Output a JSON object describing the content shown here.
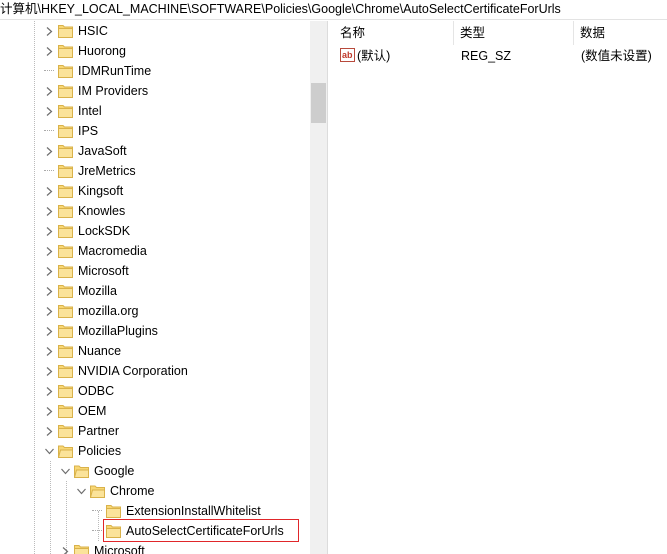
{
  "address": "计算机\\HKEY_LOCAL_MACHINE\\SOFTWARE\\Policies\\Google\\Chrome\\AutoSelectCertificateForUrls",
  "tree": [
    {
      "label": "HSIC",
      "state": "collapsed"
    },
    {
      "label": "Huorong",
      "state": "collapsed"
    },
    {
      "label": "IDMRunTime",
      "state": "leaf"
    },
    {
      "label": "IM Providers",
      "state": "collapsed"
    },
    {
      "label": "Intel",
      "state": "collapsed"
    },
    {
      "label": "IPS",
      "state": "leaf"
    },
    {
      "label": "JavaSoft",
      "state": "collapsed"
    },
    {
      "label": "JreMetrics",
      "state": "leaf"
    },
    {
      "label": "Kingsoft",
      "state": "collapsed"
    },
    {
      "label": "Knowles",
      "state": "collapsed"
    },
    {
      "label": "LockSDK",
      "state": "collapsed"
    },
    {
      "label": "Macromedia",
      "state": "collapsed"
    },
    {
      "label": "Microsoft",
      "state": "collapsed"
    },
    {
      "label": "Mozilla",
      "state": "collapsed"
    },
    {
      "label": "mozilla.org",
      "state": "collapsed"
    },
    {
      "label": "MozillaPlugins",
      "state": "collapsed"
    },
    {
      "label": "Nuance",
      "state": "collapsed"
    },
    {
      "label": "NVIDIA Corporation",
      "state": "collapsed"
    },
    {
      "label": "ODBC",
      "state": "collapsed"
    },
    {
      "label": "OEM",
      "state": "collapsed"
    },
    {
      "label": "Partner",
      "state": "collapsed"
    },
    {
      "label": "Policies",
      "state": "expanded"
    },
    {
      "label": "Google",
      "state": "expanded"
    },
    {
      "label": "Chrome",
      "state": "expanded"
    },
    {
      "label": "ExtensionInstallWhitelist",
      "state": "leaf"
    },
    {
      "label": "AutoSelectCertificateForUrls",
      "state": "leaf-selected"
    },
    {
      "label": "Microsoft",
      "state": "collapsed"
    }
  ],
  "columns": {
    "name": "名称",
    "type": "类型",
    "data": "数据"
  },
  "values": [
    {
      "name": "(默认)",
      "type": "REG_SZ",
      "data": "(数值未设置)",
      "icon": "string-value-icon"
    }
  ]
}
